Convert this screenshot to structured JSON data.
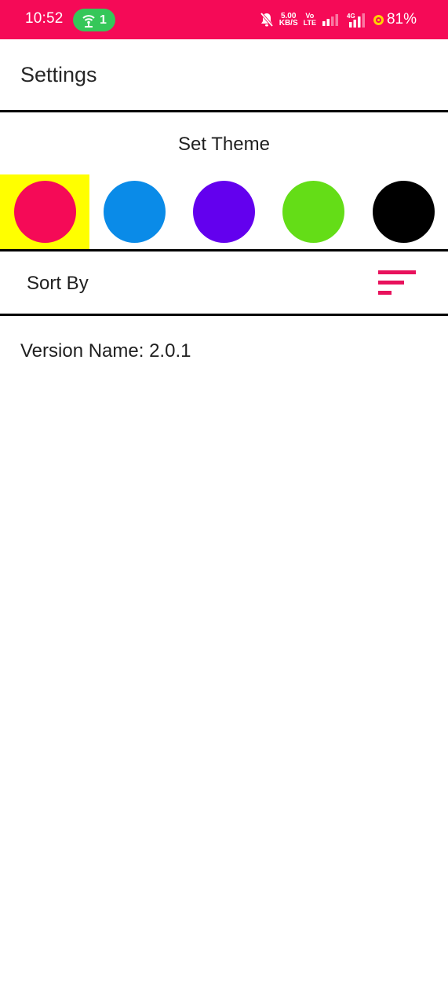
{
  "status_bar": {
    "time": "10:52",
    "hotspot_count": "1",
    "net_speed_value": "5.00",
    "net_speed_unit": "KB/S",
    "volte_top": "Vo",
    "volte_bottom": "LTE",
    "network_type": "4G",
    "battery_percent": "81%",
    "background_color": "#f50a57"
  },
  "app_bar": {
    "title": "Settings"
  },
  "theme": {
    "heading": "Set Theme",
    "selected_index": 0,
    "selection_highlight_color": "#ffff00",
    "swatches": [
      {
        "name": "pink",
        "color": "#f50a57"
      },
      {
        "name": "blue",
        "color": "#0a8be8"
      },
      {
        "name": "purple",
        "color": "#6300ee"
      },
      {
        "name": "green",
        "color": "#64dd17"
      },
      {
        "name": "black",
        "color": "#000000"
      }
    ]
  },
  "sort": {
    "label": "Sort By",
    "icon": "sort-icon",
    "icon_color": "#e8115c"
  },
  "version": {
    "text": "Version Name: 2.0.1"
  }
}
